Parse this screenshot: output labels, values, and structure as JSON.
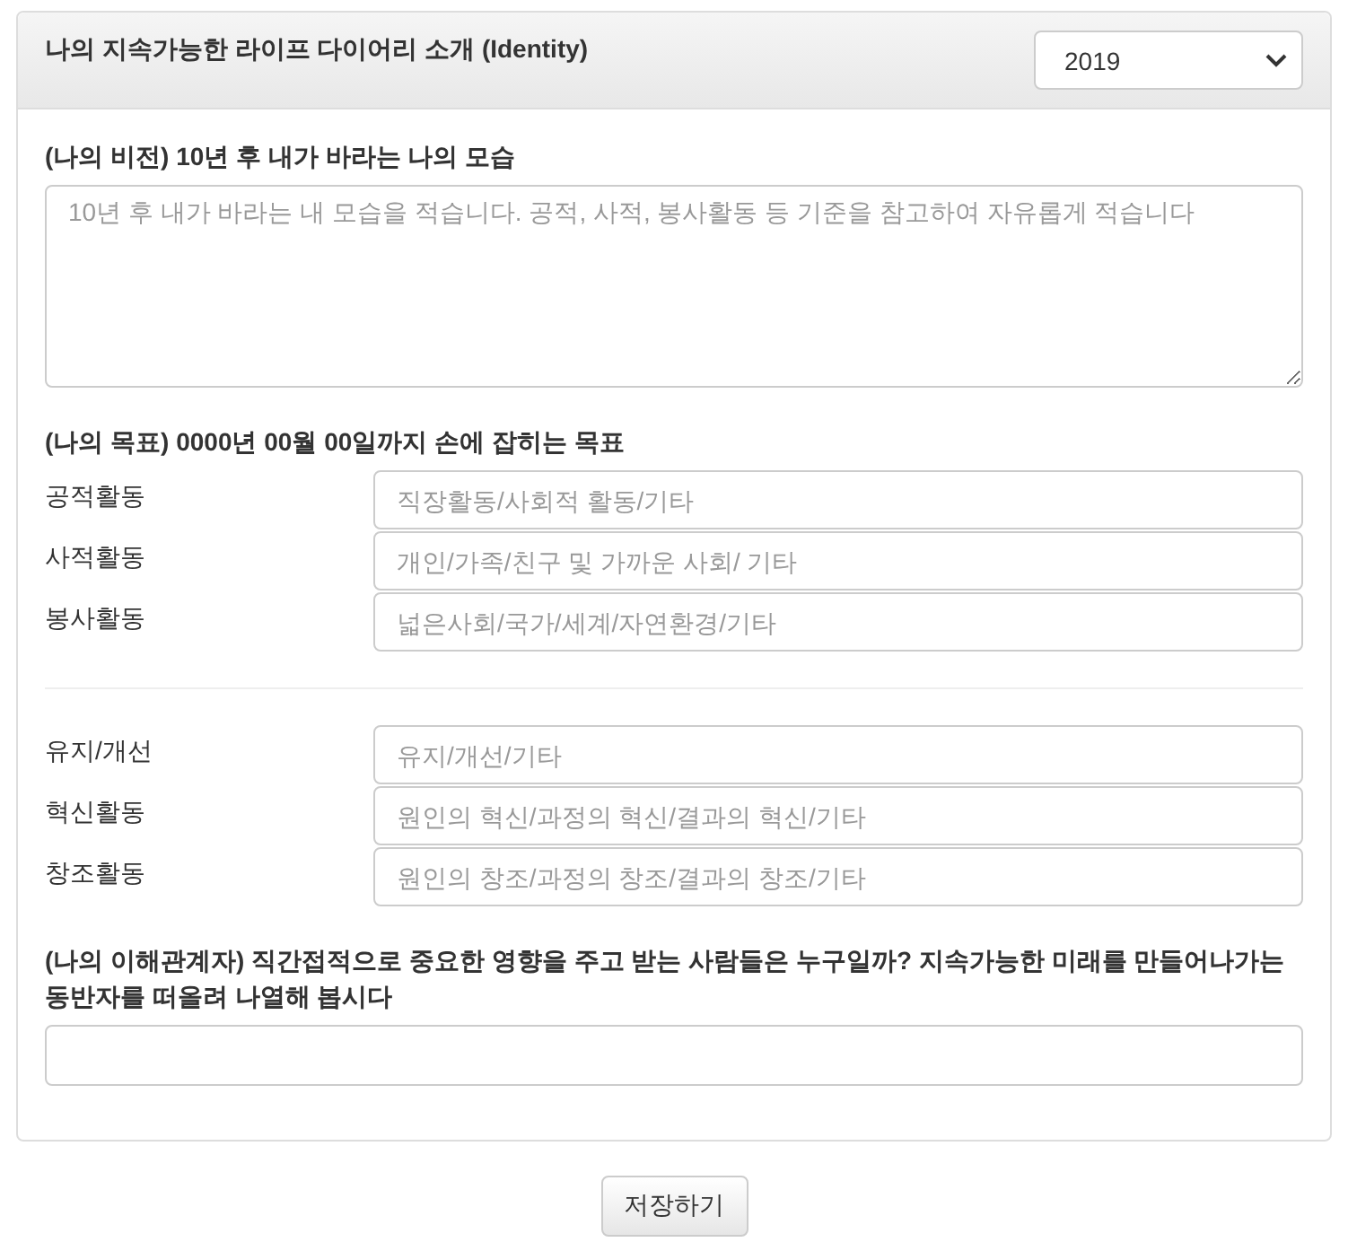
{
  "panel": {
    "title": "나의 지속가능한 라이프 다이어리 소개 (Identity)",
    "year_select": {
      "value": "2019"
    }
  },
  "vision": {
    "label": "(나의 비전) 10년 후 내가 바라는 나의 모습",
    "textarea": {
      "placeholder": "10년 후 내가 바라는 내 모습을 적습니다. 공적, 사적, 봉사활동 등 기준을 참고하여 자유롭게 적습니다"
    }
  },
  "goals": {
    "label": "(나의 목표) 0000년 00월 00일까지 손에 잡히는 목표",
    "groups": [
      [
        {
          "label": "공적활동",
          "placeholder": "직장활동/사회적 활동/기타"
        },
        {
          "label": "사적활동",
          "placeholder": "개인/가족/친구 및 가까운 사회/ 기타"
        },
        {
          "label": "봉사활동",
          "placeholder": "넓은사회/국가/세계/자연환경/기타"
        }
      ],
      [
        {
          "label": "유지/개선",
          "placeholder": "유지/개선/기타"
        },
        {
          "label": "혁신활동",
          "placeholder": "원인의 혁신/과정의 혁신/결과의 혁신/기타"
        },
        {
          "label": "창조활동",
          "placeholder": "원인의 창조/과정의 창조/결과의 창조/기타"
        }
      ]
    ]
  },
  "stakeholders": {
    "label": "(나의 이해관계자) 직간접적으로 중요한 영향을 주고 받는 사람들은 누구일까? 지속가능한 미래를 만들어나가는 동반자를 떠올려 나열해 봅시다"
  },
  "save_button": "저장하기"
}
